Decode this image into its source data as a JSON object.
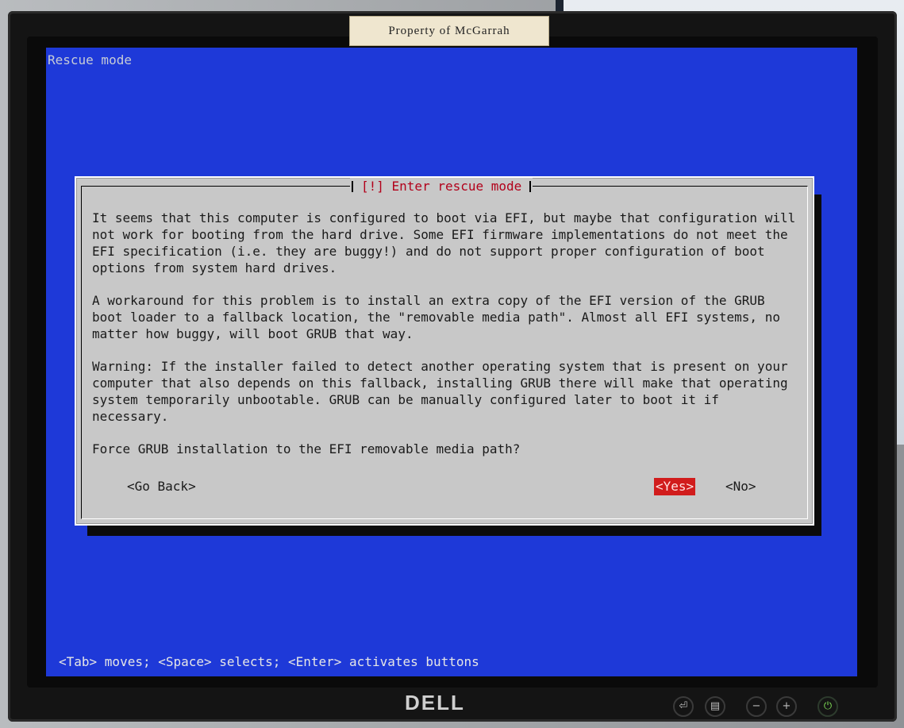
{
  "sticker": {
    "text": "Property of McGarrah"
  },
  "screen": {
    "title": "Rescue mode"
  },
  "dialog": {
    "title": "[!] Enter rescue mode",
    "paragraphs": [
      "It seems that this computer is configured to boot via EFI, but maybe that configuration will not work for booting from the hard drive. Some EFI firmware implementations do not meet the EFI specification (i.e. they are buggy!) and do not support proper configuration of boot options from system hard drives.",
      "A workaround for this problem is to install an extra copy of the EFI version of the GRUB boot loader to a fallback location, the \"removable media path\". Almost all EFI systems, no matter how buggy, will boot GRUB that way.",
      "Warning: If the installer failed to detect another operating system that is present on your computer that also depends on this fallback, installing GRUB there will make that operating system temporarily unbootable. GRUB can be manually configured later to boot it if necessary.",
      "Force GRUB installation to the EFI removable media path?"
    ],
    "buttons": {
      "back": "<Go Back>",
      "yes": "<Yes>",
      "no": "<No>"
    }
  },
  "status_line": "<Tab> moves; <Space> selects; <Enter> activates buttons",
  "monitor": {
    "brand": "DELL",
    "controls": [
      "input-select-icon",
      "menu-icon",
      "minus-icon",
      "plus-icon",
      "power-icon"
    ]
  },
  "colors": {
    "screen_bg": "#1e39d8",
    "dialog_bg": "#c8c8c8",
    "title_red": "#b2001a",
    "selected_button": "#d11c1c"
  }
}
